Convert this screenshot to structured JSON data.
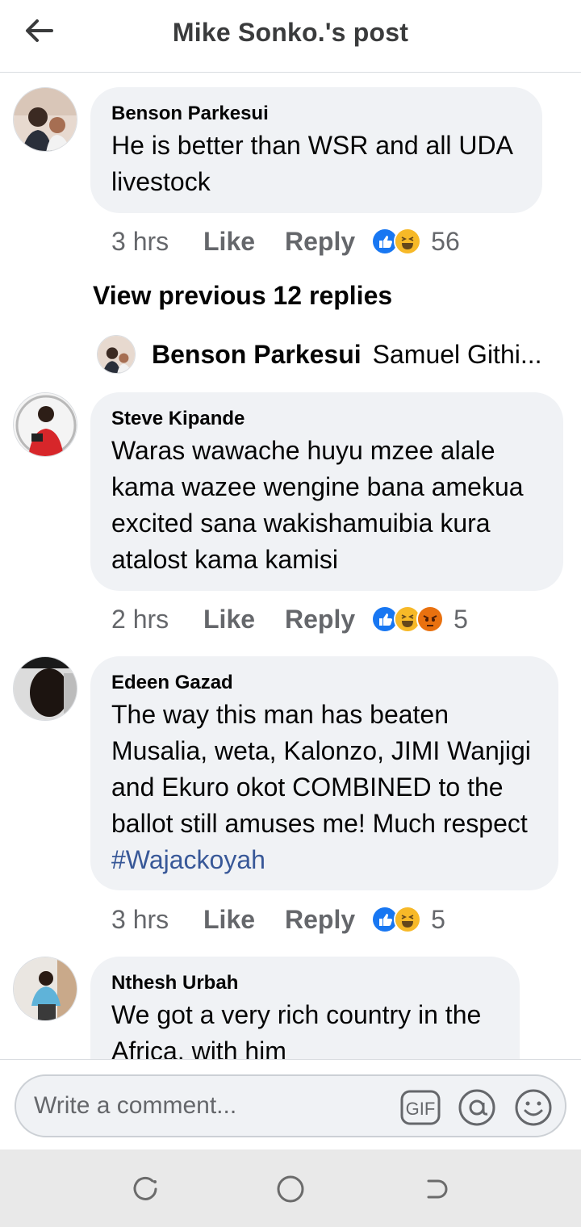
{
  "header": {
    "title": "Mike Sonko.'s post",
    "back_icon": "arrow-left-icon"
  },
  "comments": [
    {
      "name": "Benson Parkesui",
      "text": "He is better than WSR and all UDA livestock",
      "time": "3 hrs",
      "like_label": "Like",
      "reply_label": "Reply",
      "reactions": [
        "like",
        "haha"
      ],
      "reaction_count": "56"
    },
    {
      "name": "Steve Kipande",
      "text": "Waras wawache huyu mzee alale kama wazee wengine bana amekua excited sana wakishamuibia kura atalost kama kamisi",
      "time": "2 hrs",
      "like_label": "Like",
      "reply_label": "Reply",
      "reactions": [
        "like",
        "haha",
        "angry"
      ],
      "reaction_count": "5"
    },
    {
      "name": "Edeen Gazad",
      "text": "The way this man has beaten Musalia, weta, Kalonzo, JIMI Wanjigi and Ekuro okot COMBINED to the ballot still amuses me! Much respect",
      "hashtag": "#Wajackoyah",
      "time": "3 hrs",
      "like_label": "Like",
      "reply_label": "Reply",
      "reactions": [
        "like",
        "haha"
      ],
      "reaction_count": "5"
    },
    {
      "name": "Nthesh Urbah",
      "text": "We got a very rich country in the Africa, with him"
    }
  ],
  "view_previous": "View previous 12 replies",
  "reply_preview": {
    "name": "Benson Parkesui",
    "text": "Samuel Githi..."
  },
  "composer": {
    "placeholder": "Write a comment...",
    "gif_label": "GIF",
    "icons": [
      "gif-icon",
      "at-mention-icon",
      "emoji-icon"
    ]
  },
  "colors": {
    "bubble": "#f0f2f5",
    "secondary_text": "#65676b",
    "hashtag": "#385898",
    "like_blue": "#1877f2",
    "haha_yellow": "#f7b928",
    "angry_orange": "#e9710f"
  }
}
